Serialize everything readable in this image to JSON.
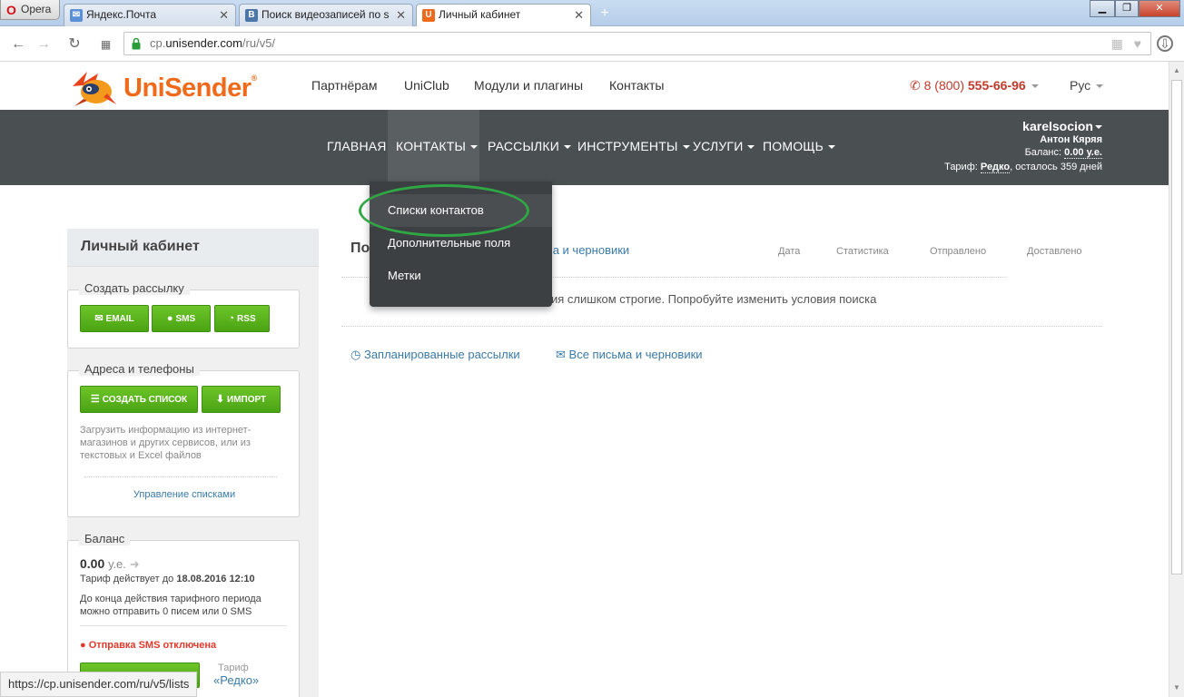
{
  "browser": {
    "menu_label": "Opera",
    "tabs": [
      {
        "label": "Яндекс.Почта"
      },
      {
        "label": "Поиск видеозаписей по s"
      },
      {
        "label": "Личный кабинет"
      }
    ],
    "url_prefix": "cp.",
    "url_host": "unisender.com",
    "url_path": "/ru/v5/",
    "status_url": "https://cp.unisender.com/ru/v5/lists"
  },
  "site": {
    "logo_text": "UniSender",
    "logo_reg": "®",
    "top_links": [
      "Партнёрам",
      "UniClub",
      "Модули и плагины",
      "Контакты"
    ],
    "phone_prefix": "8 (800)",
    "phone_number": "555-66-96",
    "lang": "Рус"
  },
  "nav": {
    "items": [
      "ГЛАВНАЯ",
      "КОНТАКТЫ",
      "РАССЫЛКИ",
      "ИНСТРУМЕНТЫ",
      "УСЛУГИ",
      "ПОМОЩЬ"
    ],
    "active_index": 1
  },
  "user": {
    "login": "karelsocion",
    "full_name": "Антон Кяряя",
    "balance_label": "Баланс:",
    "balance_value": "0.00 у.е.",
    "tariff_label": "Тариф:",
    "tariff_name": "Редко",
    "tariff_rest": ", осталось 359 дней"
  },
  "dropdown": {
    "items": [
      "Списки контактов",
      "Дополнительные поля",
      "Метки"
    ],
    "highlighted_index": 0
  },
  "sidebar": {
    "title": "Личный кабинет",
    "create": {
      "legend": "Создать рассылку",
      "buttons": [
        "EMAIL",
        "SMS",
        "RSS"
      ]
    },
    "addresses": {
      "legend": "Адреса и телефоны",
      "buttons": [
        "СОЗДАТЬ СПИСОК",
        "ИМПОРТ"
      ],
      "hint": "Загрузить информацию из интернет-магазинов и других сервисов, или из текстовых и Excel файлов",
      "manage_link": "Управление списками"
    },
    "balance": {
      "legend": "Баланс",
      "value": "0.00",
      "unit": "у.е.",
      "tariff_valid_label": "Тариф действует до",
      "tariff_valid_date": "18.08.2016 12:10",
      "remaining_text": "До конца действия тарифного периода можно отправить 0 писем или 0 SMS",
      "sms_disabled": "Отправка SMS отключена",
      "tariff_label": "Тариф",
      "tariff_name": "«Редко»"
    }
  },
  "content": {
    "heading_visible": "По",
    "tab_partial": "ьма и черновики",
    "columns": [
      "Дата",
      "Статистика",
      "Отправлено",
      "Доставлено"
    ],
    "empty_message_partial": "ия слишком строгие. Попробуйте изменить условия поиска",
    "bottom_links": [
      "Запланированные рассылки",
      "Все письма и черновики"
    ]
  },
  "colors": {
    "accent_orange": "#f06a1c",
    "nav_bg": "#4a4f52",
    "green_button": "#4aa312",
    "link_blue": "#3a7aa8",
    "annotation_green": "#2fa844"
  }
}
